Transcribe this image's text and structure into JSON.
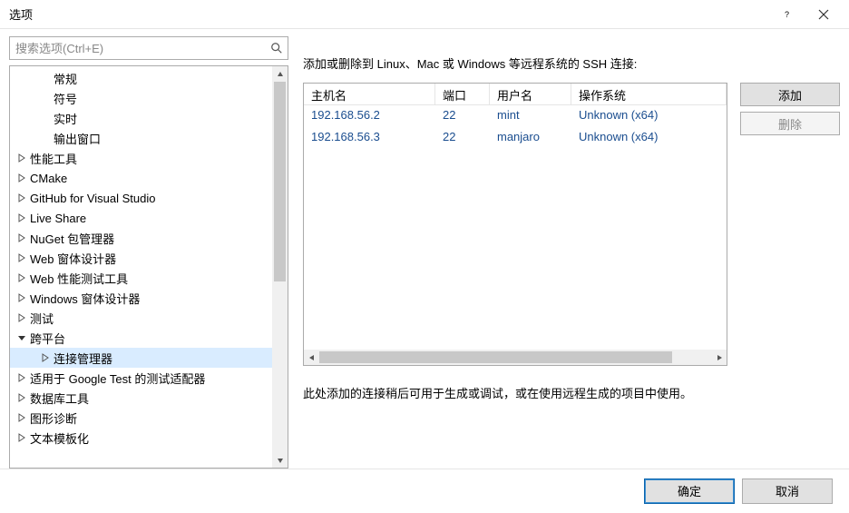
{
  "window": {
    "title": "选项"
  },
  "search": {
    "placeholder": "搜索选项(Ctrl+E)"
  },
  "tree": {
    "items": [
      {
        "label": "常规",
        "depth": 1,
        "expandable": false
      },
      {
        "label": "符号",
        "depth": 1,
        "expandable": false
      },
      {
        "label": "实时",
        "depth": 1,
        "expandable": false
      },
      {
        "label": "输出窗口",
        "depth": 1,
        "expandable": false
      },
      {
        "label": "性能工具",
        "depth": 0,
        "expandable": true,
        "expanded": false
      },
      {
        "label": "CMake",
        "depth": 0,
        "expandable": true,
        "expanded": false
      },
      {
        "label": "GitHub for Visual Studio",
        "depth": 0,
        "expandable": true,
        "expanded": false
      },
      {
        "label": "Live Share",
        "depth": 0,
        "expandable": true,
        "expanded": false
      },
      {
        "label": "NuGet 包管理器",
        "depth": 0,
        "expandable": true,
        "expanded": false
      },
      {
        "label": "Web 窗体设计器",
        "depth": 0,
        "expandable": true,
        "expanded": false
      },
      {
        "label": "Web 性能测试工具",
        "depth": 0,
        "expandable": true,
        "expanded": false
      },
      {
        "label": "Windows 窗体设计器",
        "depth": 0,
        "expandable": true,
        "expanded": false
      },
      {
        "label": "测试",
        "depth": 0,
        "expandable": true,
        "expanded": false
      },
      {
        "label": "跨平台",
        "depth": 0,
        "expandable": true,
        "expanded": true
      },
      {
        "label": "连接管理器",
        "depth": 1,
        "expandable": true,
        "expanded": false,
        "selected": true
      },
      {
        "label": "适用于 Google Test 的测试适配器",
        "depth": 0,
        "expandable": true,
        "expanded": false
      },
      {
        "label": "数据库工具",
        "depth": 0,
        "expandable": true,
        "expanded": false
      },
      {
        "label": "图形诊断",
        "depth": 0,
        "expandable": true,
        "expanded": false
      },
      {
        "label": "文本模板化",
        "depth": 0,
        "expandable": true,
        "expanded": false
      }
    ]
  },
  "panel": {
    "description": "添加或删除到 Linux、Mac 或 Windows 等远程系统的 SSH 连接:",
    "columns": {
      "host": "主机名",
      "port": "端口",
      "user": "用户名",
      "os": "操作系统"
    },
    "rows": [
      {
        "host": "192.168.56.2",
        "port": "22",
        "user": "mint",
        "os": "Unknown (x64)"
      },
      {
        "host": "192.168.56.3",
        "port": "22",
        "user": "manjaro",
        "os": "Unknown (x64)"
      }
    ],
    "buttons": {
      "add": "添加",
      "delete": "删除"
    },
    "note": "此处添加的连接稍后可用于生成或调试，或在使用远程生成的项目中使用。"
  },
  "footer": {
    "ok": "确定",
    "cancel": "取消"
  }
}
